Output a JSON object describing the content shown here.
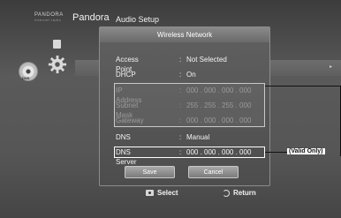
{
  "header": {
    "pandora_logo": "PANDORA",
    "pandora_logo_sub": "internet radio",
    "pandora_label": "Pandora",
    "section_title": "Audio Setup"
  },
  "menu": {
    "arrow": "▸"
  },
  "dialog": {
    "title": "Wireless Network",
    "rows": [
      {
        "label": "Access Point",
        "colon": ":",
        "value": "Not Selected"
      },
      {
        "label": "DHCP",
        "colon": ":",
        "value": "On"
      },
      {
        "label": "IP Address",
        "colon": ":",
        "value": "000 . 000 . 000 . 000"
      },
      {
        "label": "Subnet Mask",
        "colon": ":",
        "value": "255 . 255 . 255 . 000"
      },
      {
        "label": "Gateway",
        "colon": ":",
        "value": "000 . 000 . 000 . 000"
      },
      {
        "label": "DNS",
        "colon": ":",
        "value": "Manual"
      },
      {
        "label": "DNS Server",
        "colon": ":",
        "value": "000 . 000 . 000 . 000"
      }
    ],
    "save_label": "Save",
    "cancel_label": "Cancel"
  },
  "footer": {
    "select_label": "Select",
    "return_label": "Return"
  },
  "annotations": {
    "valid_only": "(Valid Only)"
  },
  "icons": {
    "disc_label": "DVD"
  },
  "colors": {
    "background": "#565656",
    "dialog": "#5a5a5a",
    "text": "#f4f4f4",
    "dim_text": "#9a9a9a"
  }
}
